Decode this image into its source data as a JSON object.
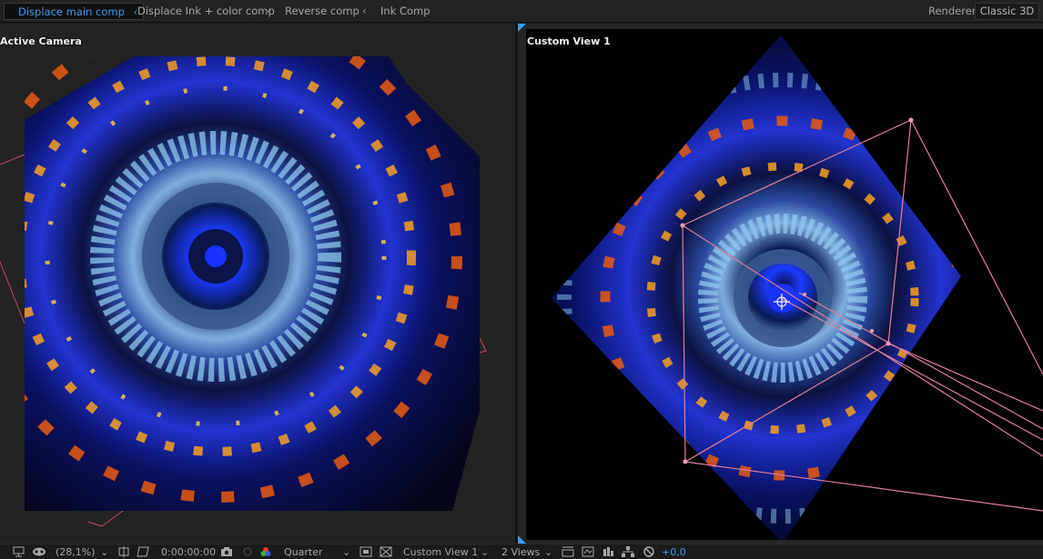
{
  "tabs": [
    {
      "label": "Displace main comp",
      "active": true
    },
    {
      "label": "Displace Ink + color comp",
      "active": false
    },
    {
      "label": "Reverse comp",
      "active": false
    },
    {
      "label": "Ink Comp",
      "active": false
    }
  ],
  "renderer": {
    "label": "Renderer:",
    "value": "Classic 3D"
  },
  "views": {
    "left": {
      "label": "Active Camera"
    },
    "right": {
      "label": "Custom View 1"
    }
  },
  "bottom": {
    "magnification": "(28,1%)",
    "timecode": "0:00:00:00",
    "resolution": "Quarter",
    "view_select": "Custom View 1",
    "layout_select": "2 Views",
    "exposure": "+0,0"
  },
  "colors": {
    "accent": "#3b9cf0",
    "camera_wireframe": "#e0607a"
  },
  "icons": [
    "monitor-icon",
    "mask-icon",
    "dropdown-chevron-icon",
    "region-of-interest-icon",
    "transparency-grid-icon",
    "snapshot-icon",
    "show-snapshot-icon",
    "color-channel-icon",
    "fast-previews-icon",
    "grid-guides-icon",
    "3d-view-icon",
    "draft-3d-icon",
    "flowchart-icon",
    "reset-exposure-icon"
  ]
}
